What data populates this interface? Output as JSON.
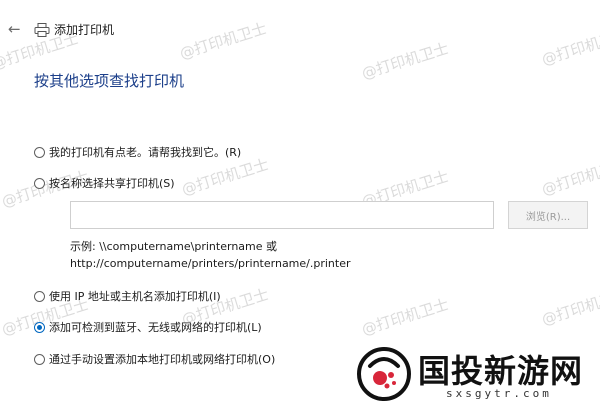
{
  "header": {
    "back_icon": "back-arrow-icon",
    "printer_icon": "printer-icon",
    "title": "添加打印机"
  },
  "heading": "按其他选项查找打印机",
  "options": [
    {
      "label": "我的打印机有点老。请帮我找到它。(R)",
      "checked": false
    },
    {
      "label": "按名称选择共享打印机(S)",
      "checked": false
    },
    {
      "label": "使用 IP 地址或主机名添加打印机(I)",
      "checked": false
    },
    {
      "label": "添加可检测到蓝牙、无线或网络的打印机(L)",
      "checked": true
    },
    {
      "label": "通过手动设置添加本地打印机或网络打印机(O)",
      "checked": false
    }
  ],
  "share_name": {
    "value": "",
    "browse_label": "浏览(R)...",
    "example_line1": "示例: \\\\computername\\printername 或",
    "example_line2": "http://computername/printers/printername/.printer"
  },
  "watermark_text": "@打印机卫士",
  "logo": {
    "brand": "国投新游网",
    "url": "sxsgytr.com"
  },
  "colors": {
    "heading": "#1c3f8a",
    "accent": "#0067c0",
    "watermark": "#bebebe"
  }
}
